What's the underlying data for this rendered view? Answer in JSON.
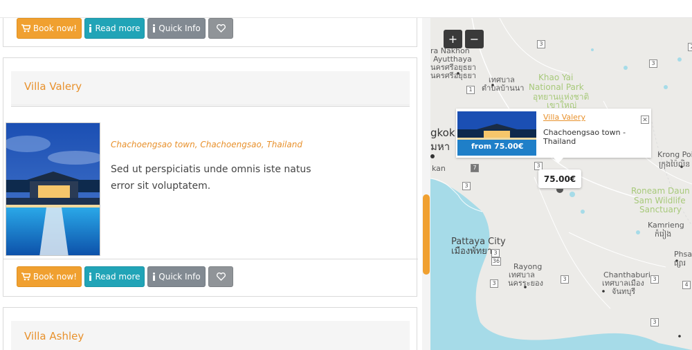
{
  "buttons": {
    "book_now": "Book now!",
    "read_more": "Read more",
    "quick_info": "Quick Info"
  },
  "listings": [
    {
      "title": "Villa Valery",
      "location": "Chachoengsao town, Chachoengsao, Thailand",
      "description": "Sed ut perspiciatis unde omnis iste natus error sit voluptatem."
    },
    {
      "title": "Villa Ashley"
    }
  ],
  "map": {
    "zoom_in": "+",
    "zoom_out": "−",
    "popup": {
      "title": "Villa Valery",
      "location": "Chachoengsao town - Thailand",
      "image_price": "from 75.00€"
    },
    "price_marker": "75.00€",
    "labels": {
      "nakhon": "ra Nakhon",
      "ayutthaya": "Ayutthaya",
      "thai_nakhon": "นครศรีอยุธยา",
      "thai_ayutthaya": "นครศรีอยุธยา",
      "thesaban1": "เทศบาล",
      "thesaban1b": "ตำบลบ้านนา",
      "khao_yai": "Khao Yai",
      "national_park": "National Park",
      "thai_khao_yai": "อุทยานแห่งชาติ",
      "thai_khao_yai2": "เขาใหญ่",
      "bangkok": "gkok",
      "thai_bangkok": "มหา",
      "kan": "kan",
      "krong_poi": "Krong Poi",
      "thai_krong": "ក្រុងប៉ៃលិន",
      "roneam": "Roneam Daun",
      "sam_wildlife": "Sam Wildlife",
      "sanctuary": "Sanctuary",
      "kamrieng": "Kamrieng",
      "thai_kamrieng": "កំរៀង",
      "pattaya": "Pattaya City",
      "thai_pattaya": "เมืองพัทยา",
      "rayong": "Rayong",
      "thai_rayong1": "เทศบาล",
      "thai_rayong2": "นครระยอง",
      "chanthaburi": "Chanthaburi",
      "thai_chan1": "เทศบาลเมือง",
      "thai_chan2": "จันทบุรี",
      "phsar": "Phsar",
      "thai_phsar": "ផ្សារ"
    },
    "shields": [
      "3",
      "1",
      "2",
      "3",
      "7",
      "3",
      "36",
      "3",
      "3",
      "3",
      "3",
      "3",
      "4",
      "3"
    ]
  },
  "colors": {
    "accent": "#e8912c",
    "teal": "#21a4b7",
    "gray": "#828a92",
    "water": "#a6dbe8"
  }
}
